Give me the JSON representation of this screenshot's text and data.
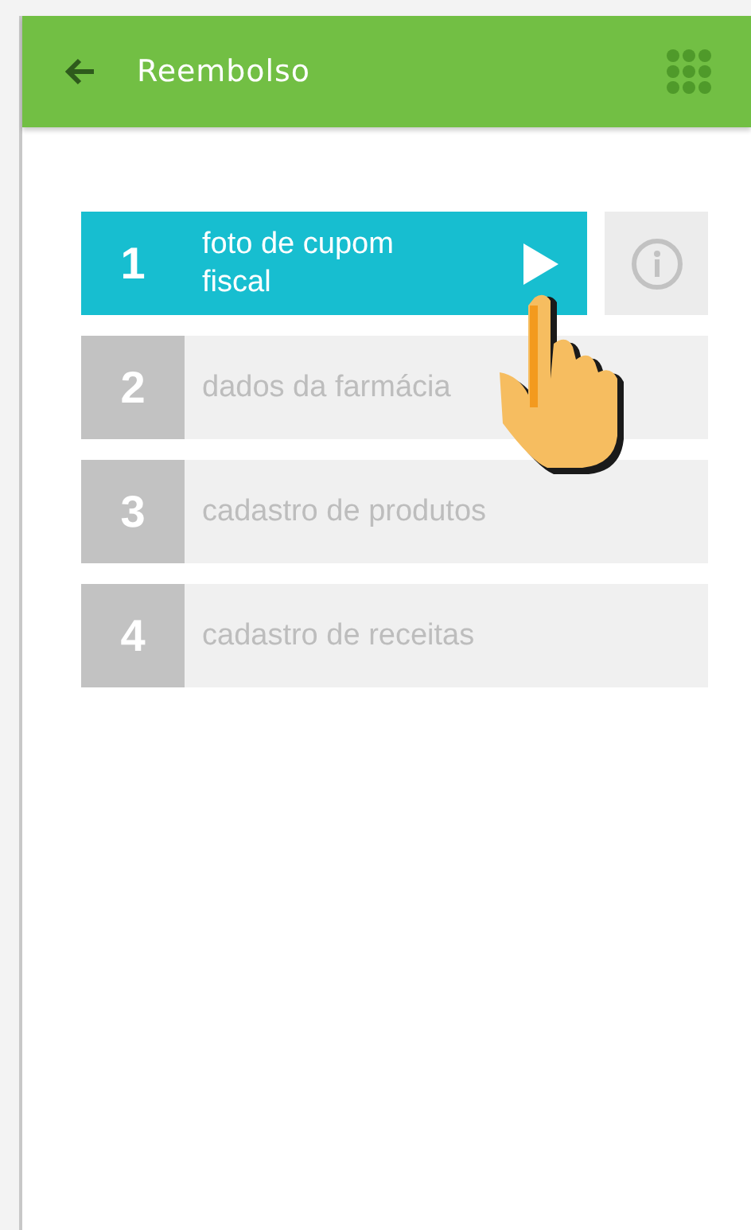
{
  "header": {
    "title": "Reembolso"
  },
  "steps": [
    {
      "number": "1",
      "label": "foto de cupom fiscal",
      "selected": true
    },
    {
      "number": "2",
      "label": "dados da farmácia",
      "selected": false
    },
    {
      "number": "3",
      "label": "cadastro de produtos",
      "selected": false
    },
    {
      "number": "4",
      "label": "cadastro de receitas",
      "selected": false
    }
  ]
}
